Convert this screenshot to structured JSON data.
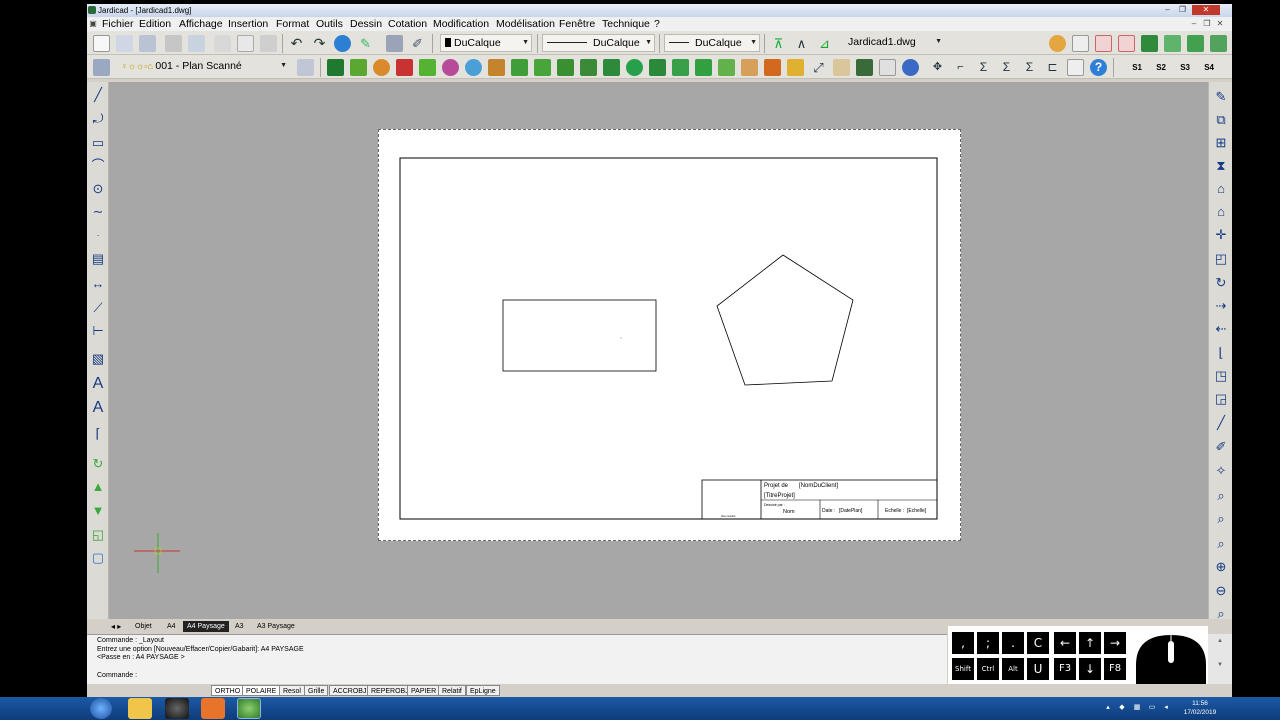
{
  "window": {
    "title": "Jardicad - [Jardicad1.dwg]",
    "buttons": [
      "‒",
      "❐",
      "✕"
    ]
  },
  "menu": {
    "items": [
      "Fichier",
      "Edition",
      "Affichage",
      "Insertion",
      "Format",
      "Outils",
      "Dessin",
      "Cotation",
      "Modification",
      "Modélisation",
      "Fenêtre",
      "Technique",
      "?"
    ]
  },
  "toolbar1": {
    "layer_combo": "DuCalque",
    "linetype_combo": "DuCalque",
    "lineweight_combo": "DuCalque",
    "file_combo": "Jardicad1.dwg",
    "icons": [
      "new-icon",
      "open-icon",
      "save-icon",
      "print-icon",
      "preview-icon",
      "cut-icon",
      "copy-icon",
      "paste-icon",
      "undo-icon",
      "redo-icon",
      "pan-icon",
      "pencil-icon",
      "grid-icon",
      "brush-icon"
    ]
  },
  "toolbar2": {
    "layer_name": "001 - Plan Scanné",
    "right_labels": [
      "S1",
      "S2",
      "S3",
      "S4"
    ]
  },
  "drawing": {
    "title_block": {
      "projet_label": "Projet de",
      "client": "[NomDuClient]",
      "titre": "[TitreProjet]",
      "dessine_par": "Dessiné par :",
      "nom": "Nom",
      "date_label": "Date :",
      "date_value": "[DatePlan]",
      "echelle_label": "Echelle :",
      "echelle_value": "[Echelle]",
      "logo_caption": "Nom société"
    }
  },
  "layout_tabs": {
    "items": [
      "Objet",
      "A4",
      "A4 Paysage",
      "A3",
      "A3 Paysage"
    ],
    "active": "A4 Paysage"
  },
  "command": {
    "line1": "Commande : _Layout",
    "line2": "Entrez une option [Nouveau/Effacer/Copier/Gabarit]: A4 PAYSAGE",
    "line3": "<Passe en : A4 PAYSAGE >",
    "prompt": "Commande :"
  },
  "keypad": {
    "row1": [
      ",",
      ";",
      ".",
      "C",
      "←",
      "↑",
      "→"
    ],
    "row2": [
      "Shift",
      "Ctrl",
      "Alt",
      "U",
      "F3",
      "↓",
      "F8"
    ]
  },
  "status": {
    "buttons": [
      "ORTHO",
      "POLAIRE",
      "Resol",
      "Grille",
      "ACCROBJ",
      "REPEROBJ",
      "PAPIER",
      "Relatif",
      "EpLigne"
    ]
  },
  "taskbar": {
    "time": "11:56",
    "date": "17/02/2019"
  }
}
